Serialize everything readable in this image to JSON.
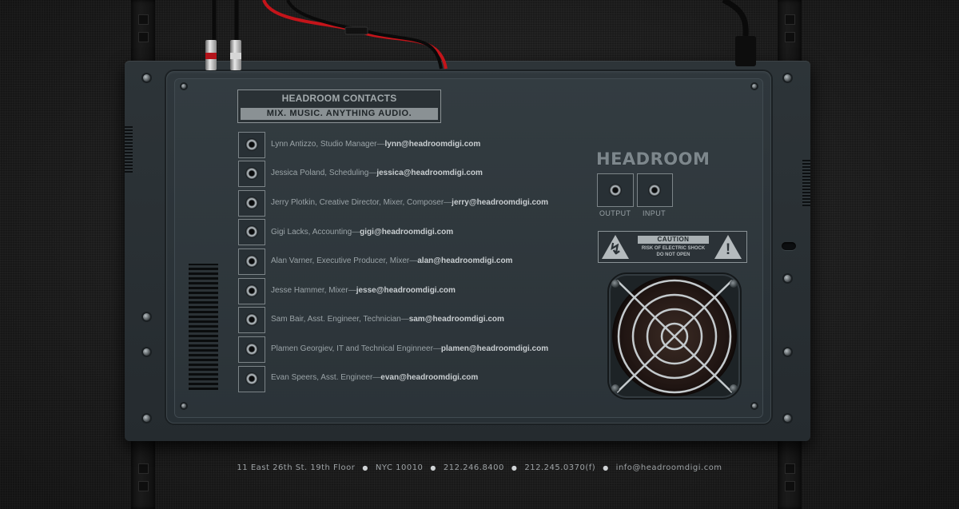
{
  "title_plate": {
    "heading": "HEADROOM CONTACTS",
    "tagline": "MIX.  MUSIC.  ANYTHING AUDIO."
  },
  "contacts": [
    {
      "name": "Lynn Antizzo, Studio Manager",
      "email": "lynn@headroomdigi.com"
    },
    {
      "name": "Jessica Poland, Scheduling",
      "email": "jessica@headroomdigi.com"
    },
    {
      "name": "Jerry Plotkin, Creative Director, Mixer, Composer",
      "email": "jerry@headroomdigi.com"
    },
    {
      "name": "Gigi Lacks, Accounting",
      "email": "gigi@headroomdigi.com"
    },
    {
      "name": "Alan Varner, Executive Producer, Mixer",
      "email": "alan@headroomdigi.com"
    },
    {
      "name": "Jesse Hammer, Mixer",
      "email": "jesse@headroomdigi.com"
    },
    {
      "name": "Sam Bair, Asst. Engineer, Technician",
      "email": "sam@headroomdigi.com"
    },
    {
      "name": "Plamen Georgiev, IT and Technical Enginneer",
      "email": "plamen@headroomdigi.com"
    },
    {
      "name": "Evan Speers, Asst. Engineer",
      "email": "evan@headroomdigi.com"
    }
  ],
  "separator": "—",
  "brand": "HEADROOM",
  "io": {
    "output_label": "OUTPUT",
    "input_label": "INPUT"
  },
  "caution": {
    "heading": "CAUTION",
    "line1": "RISK OF ELECTRIC SHOCK",
    "line2": "DO NOT OPEN",
    "left_icon": "lightning-warning-icon",
    "right_icon": "exclamation-warning-icon"
  },
  "footer": {
    "address": "11 East 26th St. 19th Floor",
    "city": "NYC 10010",
    "phone": "212.246.8400",
    "fax": "212.245.0370(f)",
    "email": "info@headroomdigi.com",
    "dot": "●"
  },
  "colors": {
    "panel": "#2f373c",
    "text": "#9aa3a7",
    "email": "#c9ced1",
    "cable_red": "#c4141a",
    "cable_black": "#0a0a0a"
  }
}
